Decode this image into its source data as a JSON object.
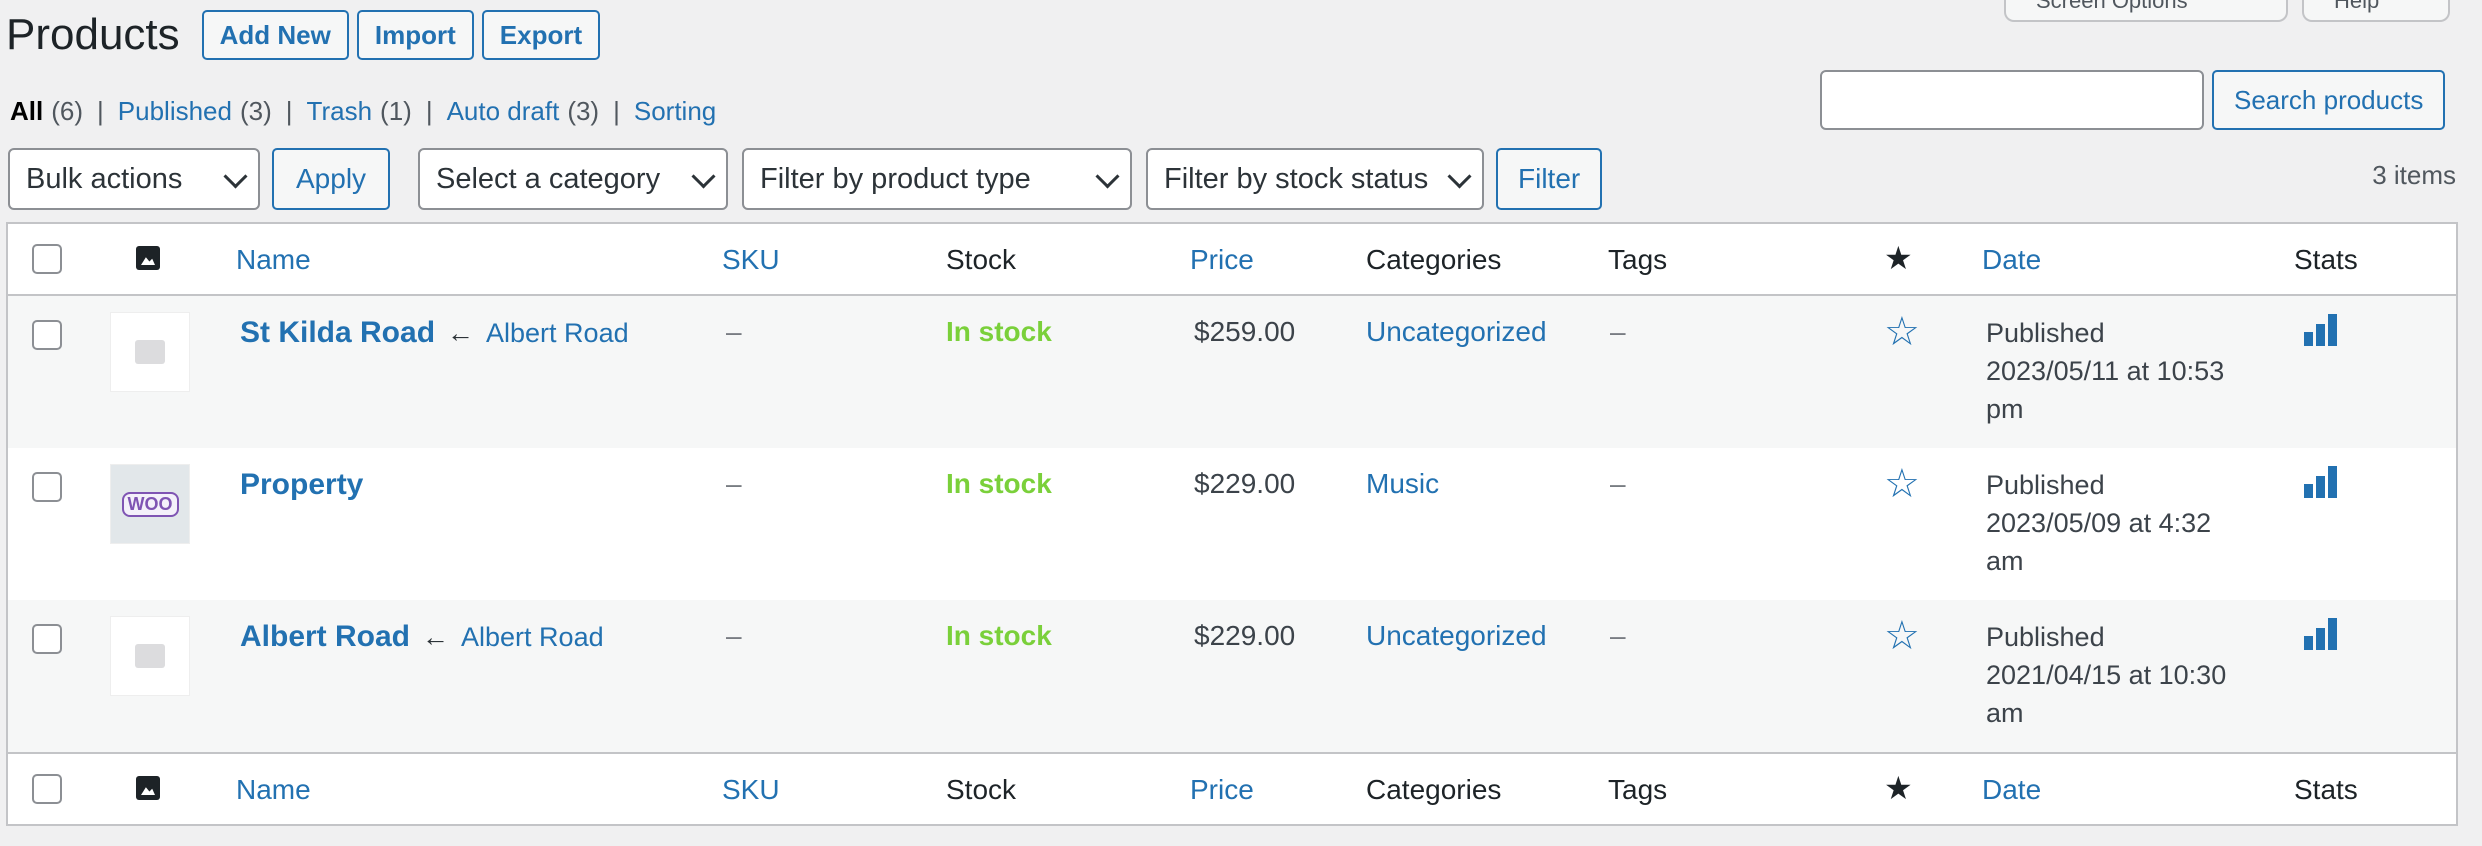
{
  "header": {
    "title": "Products",
    "buttons": {
      "add_new": "Add New",
      "import": "Import",
      "export": "Export"
    },
    "top_tabs": {
      "screen_options": "Screen Options",
      "help": "Help"
    }
  },
  "status_filters": [
    {
      "label": "All",
      "count": "(6)"
    },
    {
      "label": "Published",
      "count": "(3)"
    },
    {
      "label": "Trash",
      "count": "(1)"
    },
    {
      "label": "Auto draft",
      "count": "(3)"
    },
    {
      "label": "Sorting",
      "count": ""
    }
  ],
  "search": {
    "value": "",
    "button": "Search products"
  },
  "filters": {
    "bulk_actions": "Bulk actions",
    "apply": "Apply",
    "category": "Select a category",
    "product_type": "Filter by product type",
    "stock_status": "Filter by stock status",
    "filter": "Filter",
    "items_count": "3 items"
  },
  "columns": {
    "name": "Name",
    "sku": "SKU",
    "stock": "Stock",
    "price": "Price",
    "categories": "Categories",
    "tags": "Tags",
    "date": "Date",
    "stats": "Stats"
  },
  "rows": [
    {
      "name": "St Kilda Road",
      "arrow": "←",
      "parent": "Albert Road",
      "sku": "–",
      "stock": "In stock",
      "price": "$259.00",
      "category": "Uncategorized",
      "tags": "–",
      "date_status": "Published",
      "date_value": "2023/05/11 at 10:53 pm"
    },
    {
      "name": "Property",
      "arrow": "",
      "parent": "",
      "sku": "–",
      "stock": "In stock",
      "price": "$229.00",
      "category": "Music",
      "tags": "–",
      "date_status": "Published",
      "date_value": "2023/05/09 at 4:32 am"
    },
    {
      "name": "Albert Road",
      "arrow": "←",
      "parent": "Albert Road",
      "sku": "–",
      "stock": "In stock",
      "price": "$229.00",
      "category": "Uncategorized",
      "tags": "–",
      "date_status": "Published",
      "date_value": "2021/04/15 at 10:30 am"
    }
  ],
  "icons": {
    "image_column": "image-icon",
    "featured_column": "star-solid-icon",
    "featured_row": "star-outline-icon",
    "stats_row": "bar-chart-icon",
    "placeholder": "image-placeholder-icon",
    "woo": "WOO"
  },
  "colors": {
    "accent": "#2271b1",
    "in_stock": "#7ad03a",
    "border": "#c3c4c7",
    "background": "#f0f0f1"
  }
}
